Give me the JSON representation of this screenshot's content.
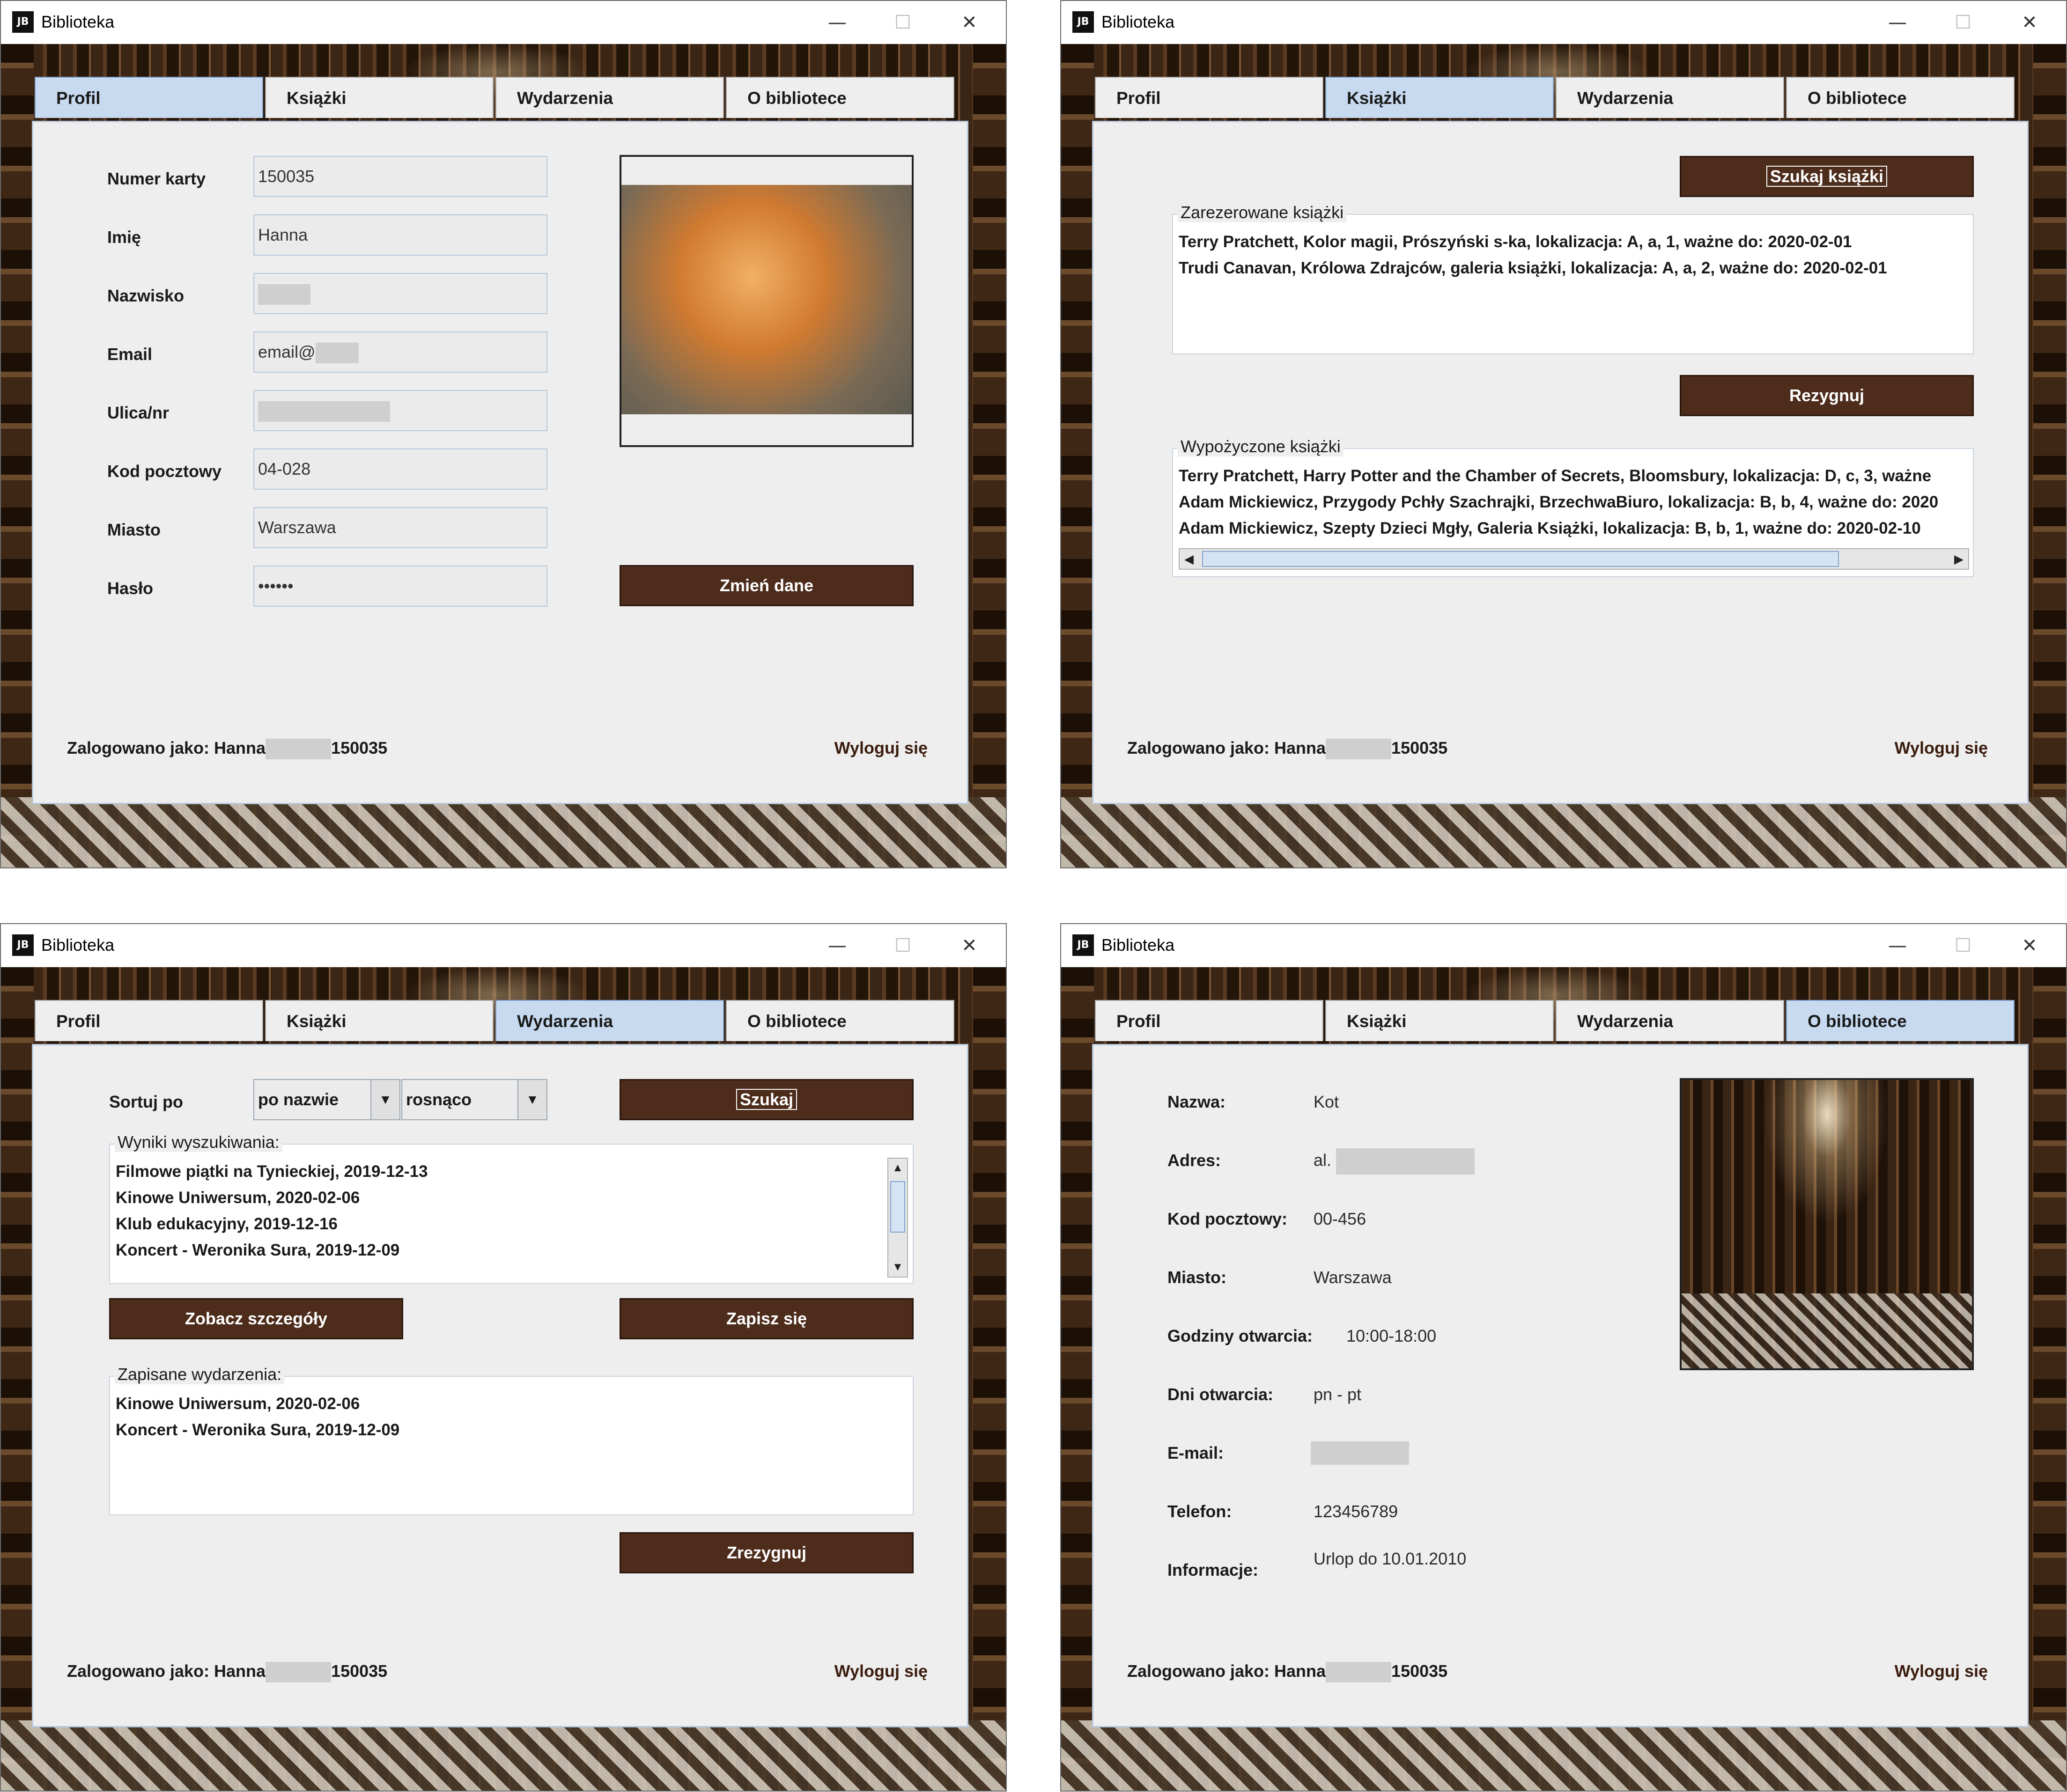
{
  "window": {
    "title": "Biblioteka",
    "icon": "JB",
    "min": "—",
    "max": "☐",
    "close": "✕"
  },
  "tabs": [
    "Profil",
    "Książki",
    "Wydarzenia",
    "O bibliotece"
  ],
  "status": {
    "logged_prefix": "Zalogowano jako: Hanna",
    "card_suffix": "150035",
    "logout": "Wyloguj się"
  },
  "profile": {
    "labels": [
      "Numer karty",
      "Imię",
      "Nazwisko",
      "Email",
      "Ulica/nr",
      "Kod pocztowy",
      "Miasto",
      "Hasło"
    ],
    "values": {
      "card": "150035",
      "name": "Hanna",
      "email_prefix": "email@",
      "postal": "04-028",
      "city": "Warszawa",
      "password": "••••••"
    },
    "photo": "cat-photo",
    "change_button": "Zmień dane"
  },
  "books": {
    "search_button": "Szukaj książki",
    "reserved_title": "Zarezerowane książki",
    "reserved": [
      "Terry Pratchett, Kolor magii, Prószyński s-ka, lokalizacja: A, a, 1, ważne do: 2020-02-01",
      "Trudi Canavan, Królowa Zdrajców, galeria książki, lokalizacja: A, a, 2, ważne do: 2020-02-01"
    ],
    "resign_button": "Rezygnuj",
    "borrowed_title": "Wypożyczone książki",
    "borrowed": [
      "Terry Pratchett, Harry Potter and the Chamber of Secrets, Bloomsbury, lokalizacja: D, c, 3, ważne",
      "Adam Mickiewicz, Przygody Pchły Szachrajki, BrzechwaBiuro, lokalizacja: B, b, 4, ważne do: 2020",
      "Adam Mickiewicz, Szepty Dzieci Mgły, Galeria Książki, lokalizacja: B, b, 1, ważne do: 2020-02-10"
    ]
  },
  "events": {
    "sort_label": "Sortuj po",
    "sort_by": "po nazwie",
    "order": "rosnąco",
    "search_button": "Szukaj",
    "results_title": "Wyniki wyszukiwania:",
    "results": [
      "Filmowe piątki na Tynieckiej, 2019-12-13",
      "Kinowe Uniwersum, 2020-02-06",
      "Klub edukacyjny, 2019-12-16",
      "Koncert - Weronika Sura, 2019-12-09"
    ],
    "details_button": "Zobacz szczegóły",
    "signup_button": "Zapisz się",
    "saved_title": "Zapisane wydarzenia:",
    "saved": [
      "Kinowe Uniwersum, 2020-02-06",
      "Koncert - Weronika Sura, 2019-12-09"
    ],
    "resign_button": "Zrezygnuj"
  },
  "about": {
    "labels": [
      "Nazwa:",
      "Adres:",
      "Kod pocztowy:",
      "Miasto:",
      "Godziny otwarcia:",
      "Dni otwarcia:",
      "E-mail:",
      "Telefon:",
      "Informacje:"
    ],
    "values": {
      "name": "Kot",
      "address_prefix": "al.",
      "postal": "00-456",
      "city": "Warszawa",
      "hours": "10:00-18:00",
      "days": "pn - pt",
      "phone": "123456789",
      "info": "Urlop do 10.01.2010"
    },
    "photo": "library-photo"
  },
  "colors": {
    "button": "#4d2c1c",
    "active_tab": "#c8daf0",
    "panel": "#eeeeee"
  }
}
